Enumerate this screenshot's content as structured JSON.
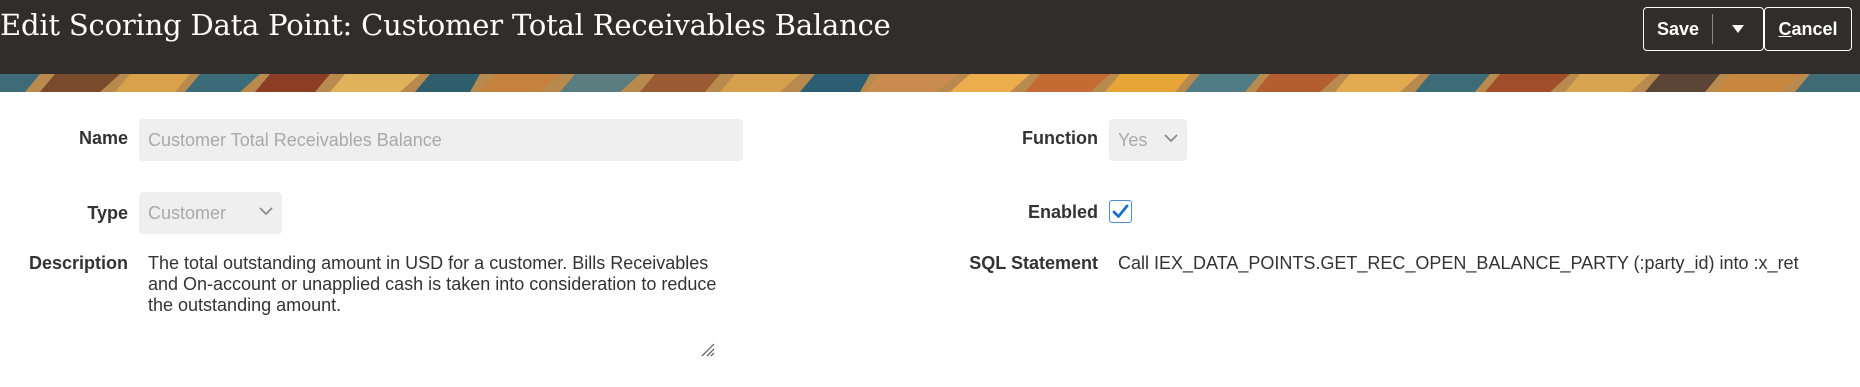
{
  "header": {
    "title": "Edit Scoring Data Point: Customer Total Receivables Balance",
    "save_label": "Save",
    "cancel_label_first": "C",
    "cancel_label_rest": "ancel",
    "background": "#312d2a"
  },
  "form": {
    "name": {
      "label": "Name",
      "value": "Customer Total Receivables Balance"
    },
    "type": {
      "label": "Type",
      "value": "Customer"
    },
    "description": {
      "label": "Description",
      "value": "The total outstanding amount in USD for a customer. Bills Receivables and On-account or unapplied cash is taken into consideration to reduce the outstanding amount."
    },
    "function": {
      "label": "Function",
      "value": "Yes"
    },
    "enabled": {
      "label": "Enabled",
      "checked": true
    },
    "sql_statement": {
      "label": "SQL Statement",
      "value": "Call IEX_DATA_POINTS.GET_REC_OPEN_BALANCE_PARTY (:party_id) into :x_ret"
    }
  },
  "icons": {
    "save_menu": "caret-down-icon",
    "select": "chevron-down-icon",
    "checkbox": "checkmark-icon",
    "resize": "resize-handle-icon"
  },
  "colors": {
    "checkbox_accent": "#1a73c8",
    "disabled_field_bg": "#efeff0",
    "disabled_text": "#a9a9a9"
  }
}
